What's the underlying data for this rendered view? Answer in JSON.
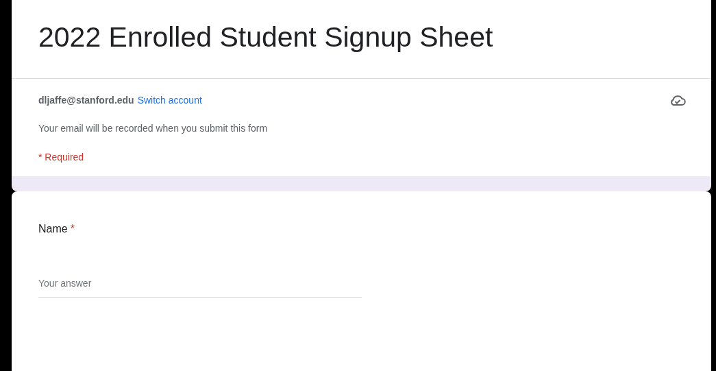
{
  "form": {
    "title": "2022 Enrolled Student Signup Sheet",
    "account_email": "dljaffe@stanford.edu",
    "switch_account_link": "Switch account",
    "email_notice": "Your email will be recorded when you submit this form",
    "required_notice": "* Required"
  },
  "questions": [
    {
      "label": "Name",
      "required_mark": "*",
      "placeholder": "Your answer"
    }
  ]
}
